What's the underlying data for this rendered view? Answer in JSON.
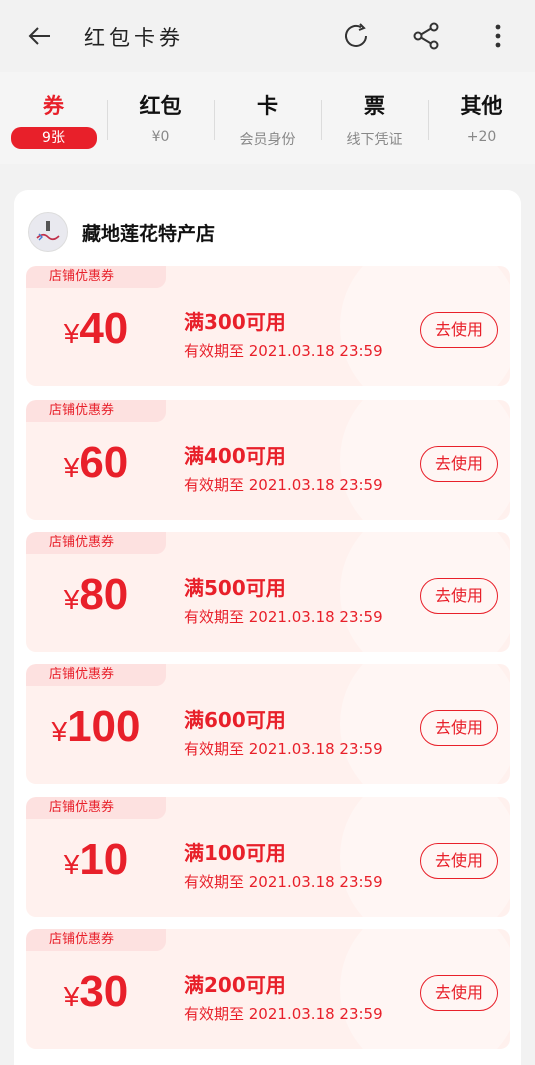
{
  "header": {
    "title": "红包卡券",
    "back_icon": "back-arrow-icon",
    "refresh_icon": "refresh-icon",
    "share_icon": "share-icon",
    "more_icon": "more-vertical-icon"
  },
  "tabs": [
    {
      "label": "券",
      "sub": "9张",
      "active": true
    },
    {
      "label": "红包",
      "sub": "¥0"
    },
    {
      "label": "卡",
      "sub": "会员身份"
    },
    {
      "label": "票",
      "sub": "线下凭证"
    },
    {
      "label": "其他",
      "sub": "+20"
    }
  ],
  "store": {
    "name": "藏地莲花特产店"
  },
  "coupons": [
    {
      "tag": "店铺优惠券",
      "currency": "¥",
      "value": "40",
      "condition": "满300可用",
      "valid": "有效期至 2021.03.18 23:59",
      "button": "去使用"
    },
    {
      "tag": "店铺优惠券",
      "currency": "¥",
      "value": "60",
      "condition": "满400可用",
      "valid": "有效期至 2021.03.18 23:59",
      "button": "去使用"
    },
    {
      "tag": "店铺优惠券",
      "currency": "¥",
      "value": "80",
      "condition": "满500可用",
      "valid": "有效期至 2021.03.18 23:59",
      "button": "去使用"
    },
    {
      "tag": "店铺优惠券",
      "currency": "¥",
      "value": "100",
      "condition": "满600可用",
      "valid": "有效期至 2021.03.18 23:59",
      "button": "去使用"
    },
    {
      "tag": "店铺优惠券",
      "currency": "¥",
      "value": "10",
      "condition": "满100可用",
      "valid": "有效期至 2021.03.18 23:59",
      "button": "去使用"
    },
    {
      "tag": "店铺优惠券",
      "currency": "¥",
      "value": "30",
      "condition": "满200可用",
      "valid": "有效期至 2021.03.18 23:59",
      "button": "去使用"
    }
  ],
  "colors": {
    "accent": "#e8202a",
    "coupon_bg": "#fff1ee",
    "tag_bg": "#fde1e0"
  }
}
